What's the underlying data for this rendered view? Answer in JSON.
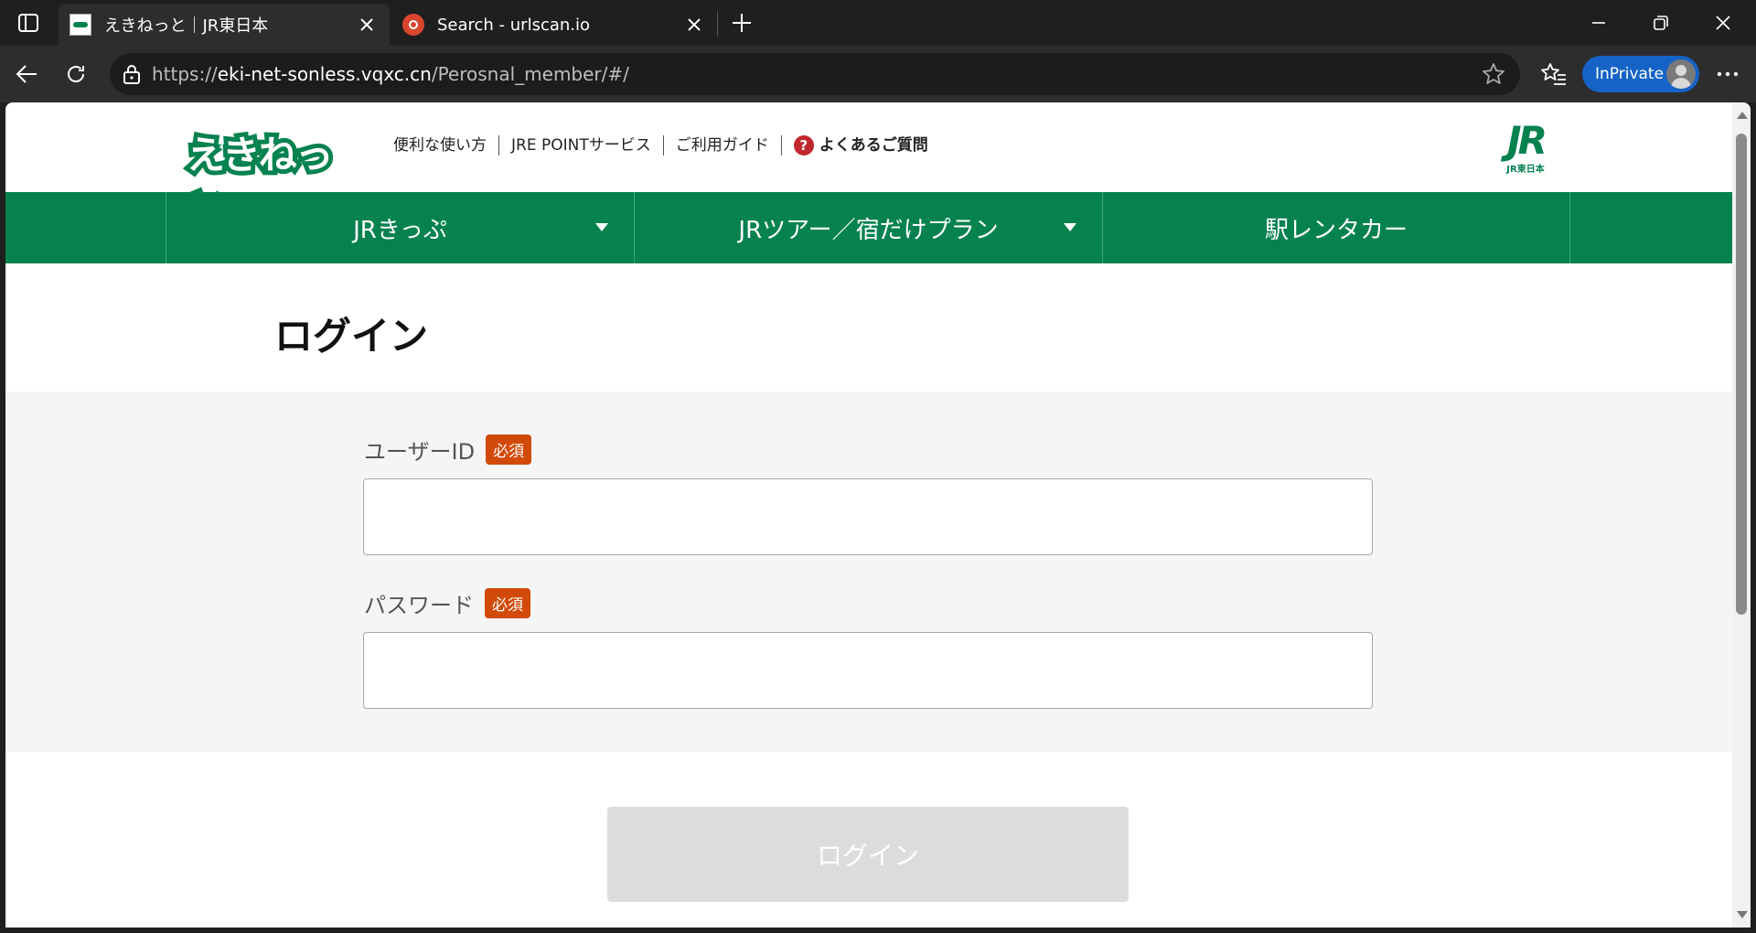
{
  "browser": {
    "tabs": [
      {
        "title": "えきねっと｜JR東日本",
        "active": true
      },
      {
        "title": "Search - urlscan.io",
        "active": false
      }
    ],
    "address": {
      "scheme": "https://",
      "host": "eki-net-sonless.vqxc.cn",
      "path": "/Perosnal_member/#/"
    },
    "inprivate_label": "InPrivate"
  },
  "header": {
    "logo_text": "えきねっと",
    "util_links": [
      {
        "label": "便利な使い方"
      },
      {
        "label": "JRE POINTサービス"
      },
      {
        "label": "ご利用ガイド"
      },
      {
        "label": "よくあるご質問"
      }
    ],
    "faq_icon_glyph": "?",
    "jr_logo_mark": "JR",
    "jr_logo_sub": "JR東日本"
  },
  "gnav": {
    "items": [
      {
        "label": "JRきっぷ",
        "has_dropdown": true
      },
      {
        "label": "JRツアー／宿だけプラン",
        "has_dropdown": true
      },
      {
        "label": "駅レンタカー",
        "has_dropdown": false
      }
    ]
  },
  "main": {
    "title": "ログイン",
    "fields": [
      {
        "label": "ユーザーID",
        "required_label": "必須",
        "value": ""
      },
      {
        "label": "パスワード",
        "required_label": "必須",
        "value": ""
      }
    ],
    "submit_label": "ログイン"
  },
  "colors": {
    "brand_green": "#06824f",
    "required_badge": "#d24a0a",
    "disabled_button": "#dcdcdc",
    "inprivate_blue": "#1563c7"
  }
}
